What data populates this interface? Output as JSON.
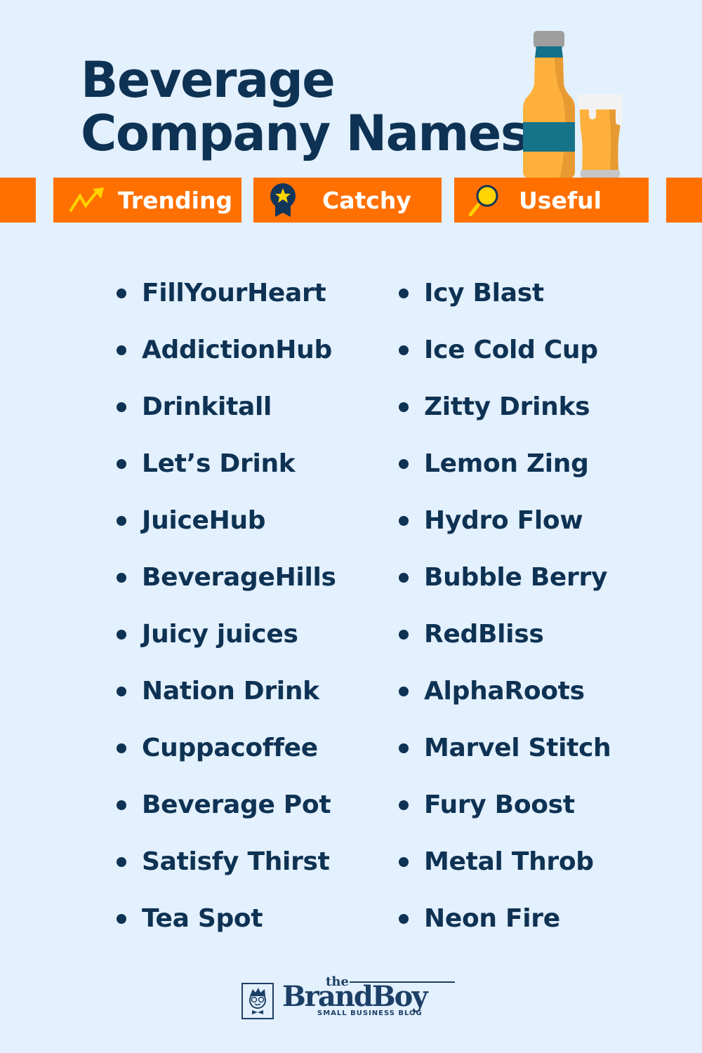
{
  "header": {
    "title_line1": "Beverage",
    "title_line2": "Company Names",
    "illustration": "beer-bottle-and-glass-icon"
  },
  "tabs": [
    {
      "label": "Trending",
      "icon": "trending-up-icon"
    },
    {
      "label": "Catchy",
      "icon": "award-ribbon-icon"
    },
    {
      "label": "Useful",
      "icon": "magnifier-icon"
    }
  ],
  "names_left": [
    "FillYourHeart",
    "AddictionHub",
    "Drinkitall",
    "Let’s Drink",
    "JuiceHub",
    "BeverageHills",
    "Juicy juices",
    "Nation Drink",
    "Cuppacoffee",
    "Beverage Pot",
    "Satisfy Thirst",
    "Tea Spot"
  ],
  "names_right": [
    "Icy Blast",
    "Ice Cold Cup",
    "Zitty Drinks",
    "Lemon Zing",
    "Hydro Flow",
    "Bubble Berry",
    "RedBliss",
    "AlphaRoots",
    "Marvel Stitch",
    "Fury Boost",
    "Metal Throb",
    "Neon Fire"
  ],
  "footer": {
    "logo_the": "the",
    "logo_brand": "BrandBoy",
    "logo_tagline": "SMALL BUSINESS BLOG"
  },
  "colors": {
    "background": "#e3f0fd",
    "accent_orange": "#ff7000",
    "text_navy": "#0e3253",
    "icon_yellow": "#ffd400"
  }
}
